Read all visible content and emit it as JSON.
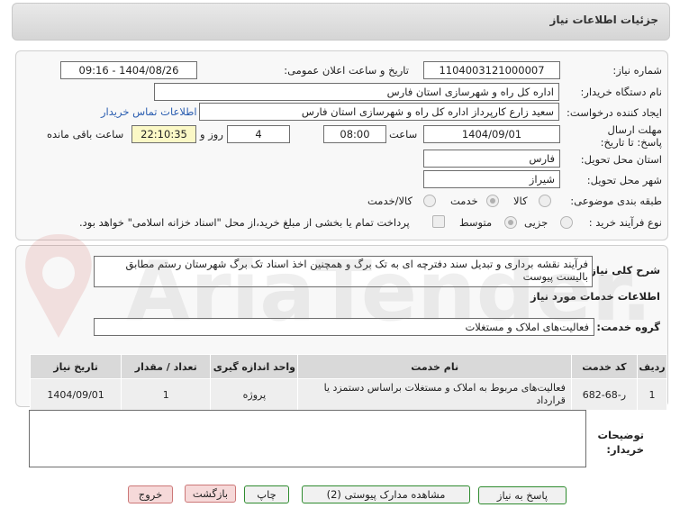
{
  "header": {
    "title": "جزئیات اطلاعات نیاز"
  },
  "form": {
    "need_number": {
      "label": "شماره نیاز:",
      "value": "1104003121000007"
    },
    "announce_datetime": {
      "label": "تاریخ و ساعت اعلان عمومی:",
      "value": "1404/08/26 - 09:16"
    },
    "buyer_org": {
      "label": "نام دستگاه خریدار:",
      "value": "اداره کل راه و شهرسازی استان فارس"
    },
    "requester": {
      "label": "ایجاد کننده درخواست:",
      "value": "سعید زارع کارپرداز اداره کل راه و شهرسازی استان فارس",
      "contact_link": "اطلاعات تماس خریدار"
    },
    "deadline": {
      "label": "مهلت ارسال پاسخ: تا تاریخ:",
      "date": "1404/09/01",
      "time_label": "ساعت",
      "time": "08:00",
      "days": "4",
      "days_label": "روز و",
      "remaining": "22:10:35",
      "remaining_label": "ساعت باقی مانده"
    },
    "province": {
      "label": "استان محل تحویل:",
      "value": "فارس"
    },
    "city": {
      "label": "شهر محل تحویل:",
      "value": "شیراز"
    },
    "category": {
      "label": "طبقه بندی موضوعی:",
      "options": [
        "کالا",
        "خدمت",
        "کالا/خدمت"
      ],
      "selected": "خدمت"
    },
    "process_type": {
      "label": "نوع فرآیند خرید :",
      "options": [
        "جزیی",
        "متوسط"
      ],
      "selected": "متوسط",
      "payment_note": "پرداخت تمام یا بخشی از مبلغ خرید،از محل \"اسناد خزانه اسلامی\" خواهد بود."
    }
  },
  "need_summary": {
    "label": "شرح کلی نیاز:",
    "text": "فرآیند نقشه برداری و تبدیل سند دفترچه ای به تک برگ و همچنین اخذ اسناد تک برگ شهرستان رستم مطابق بالیست پیوست"
  },
  "services_section": {
    "title": "اطلاعات خدمات مورد نیاز"
  },
  "service_group": {
    "label": "گروه خدمت:",
    "value": "فعالیت‌های  املاک و مستغلات"
  },
  "table": {
    "headers": [
      "ردیف",
      "کد خدمت",
      "نام خدمت",
      "واحد اندازه گیری",
      "تعداد / مقدار",
      "تاریخ نیاز"
    ],
    "rows": [
      [
        "1",
        "ر-68-682",
        "فعالیت‌های مربوط به املاک و مستغلات براساس دستمزد یا قرارداد",
        "پروژه",
        "1",
        "1404/09/01"
      ]
    ]
  },
  "buyer_notes": {
    "label": "توضیحات خریدار:",
    "value": ""
  },
  "buttons": {
    "reply": "پاسخ به نیاز",
    "view_docs": "مشاهده مدارک پیوستی (2)",
    "print": "چاپ",
    "back": "بازگشت",
    "exit": "خروج"
  },
  "watermark": "AriaTender.net"
}
